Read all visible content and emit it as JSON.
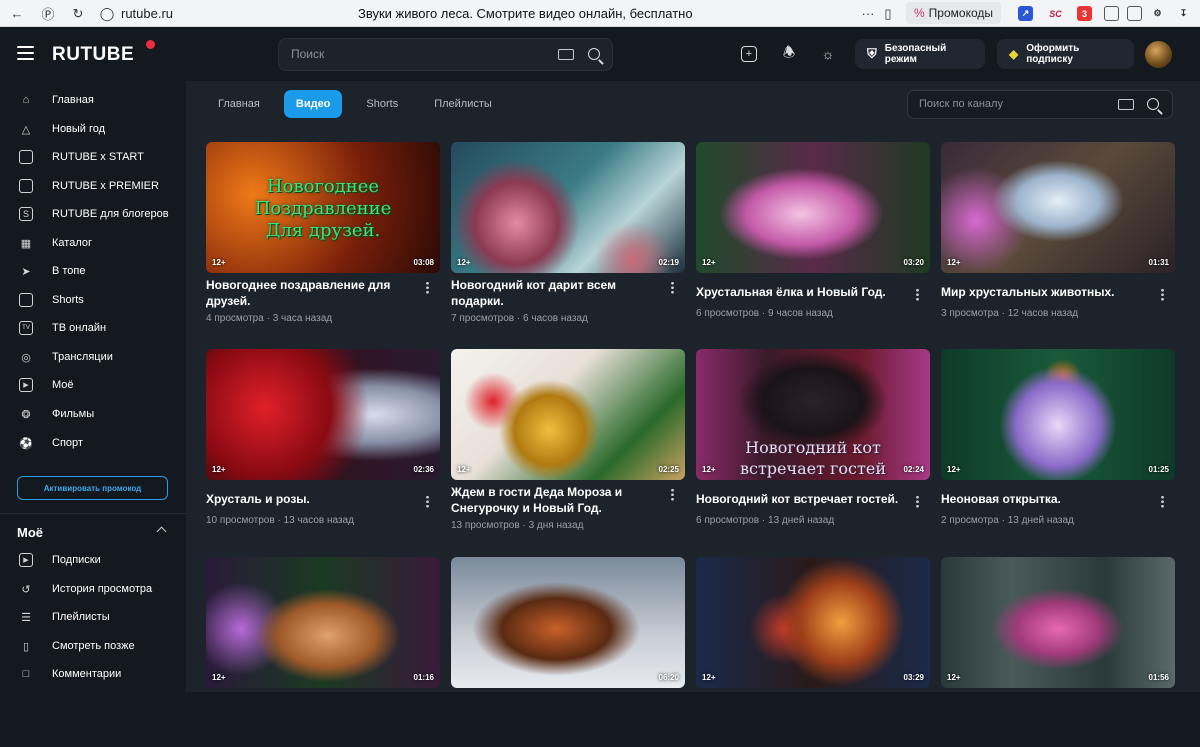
{
  "browser": {
    "url": "rutube.ru",
    "title": "Звуки живого леса. Смотрите видео онлайн, бесплатно",
    "promo_label": "Промокоды",
    "ext_badge": "3"
  },
  "header": {
    "logo": "RUTUBE",
    "search_placeholder": "Поиск",
    "safe_mode": "Безопасный режим",
    "subscribe": "Оформить подписку"
  },
  "sidebar": {
    "items": [
      {
        "label": "Главная",
        "icon": "home-icon"
      },
      {
        "label": "Новый год",
        "icon": "tree-icon"
      },
      {
        "label": "RUTUBE x START",
        "icon": "start-icon"
      },
      {
        "label": "RUTUBE x PREMIER",
        "icon": "premier-icon"
      },
      {
        "label": "RUTUBE для блогеров",
        "icon": "bloggers-icon"
      },
      {
        "label": "Каталог",
        "icon": "catalog-icon"
      },
      {
        "label": "В топе",
        "icon": "rocket-icon"
      },
      {
        "label": "Shorts",
        "icon": "shorts-icon"
      },
      {
        "label": "ТВ онлайн",
        "icon": "tv-icon"
      },
      {
        "label": "Трансляции",
        "icon": "broadcast-icon"
      },
      {
        "label": "Моё",
        "icon": "my-icon"
      },
      {
        "label": "Фильмы",
        "icon": "films-icon"
      },
      {
        "label": "Спорт",
        "icon": "sport-icon"
      }
    ],
    "promo_button": "Активировать промокод",
    "my_heading": "Моё",
    "my_items": [
      {
        "label": "Подписки",
        "icon": "subscriptions-icon"
      },
      {
        "label": "История просмотра",
        "icon": "history-icon"
      },
      {
        "label": "Плейлисты",
        "icon": "playlists-icon"
      },
      {
        "label": "Смотреть позже",
        "icon": "bookmark-icon"
      },
      {
        "label": "Комментарии",
        "icon": "comments-icon"
      }
    ]
  },
  "tabs": [
    {
      "label": "Главная",
      "active": false
    },
    {
      "label": "Видео",
      "active": true
    },
    {
      "label": "Shorts",
      "active": false
    },
    {
      "label": "Плейлисты",
      "active": false
    }
  ],
  "channel_search_placeholder": "Поиск по каналу",
  "videos": [
    {
      "title": "Новогоднее поздравление для друзей.",
      "views": "4 просмотра",
      "ago": "3 часа назад",
      "age": "12+",
      "duration": "03:08",
      "overlay": "Новогоднее Поздравление Для друзей."
    },
    {
      "title": "Новогодний кот дарит всем подарки.",
      "views": "7 просмотров",
      "ago": "6 часов назад",
      "age": "12+",
      "duration": "02:19"
    },
    {
      "title": "Хрустальная ёлка и Новый Год.",
      "views": "6 просмотров",
      "ago": "9 часов назад",
      "age": "12+",
      "duration": "03:20"
    },
    {
      "title": "Мир хрустальных животных.",
      "views": "3 просмотра",
      "ago": "12 часов назад",
      "age": "12+",
      "duration": "01:31"
    },
    {
      "title": "Хрусталь и розы.",
      "views": "10 просмотров",
      "ago": "13 часов назад",
      "age": "12+",
      "duration": "02:36"
    },
    {
      "title": "Ждем в гости Деда Мороза и Снегурочку и Новый Год.",
      "views": "13 просмотров",
      "ago": "3 дня назад",
      "age": "12+",
      "duration": "02:25"
    },
    {
      "title": "Новогодний кот встречает гостей.",
      "views": "6 просмотров",
      "ago": "13 дней назад",
      "age": "12+",
      "duration": "02:24",
      "overlay": "Новогодний кот встречает гостей"
    },
    {
      "title": "Неоновая открытка.",
      "views": "2 просмотра",
      "ago": "13 дней назад",
      "age": "12+",
      "duration": "01:25"
    },
    {
      "title": "",
      "views": "",
      "ago": "",
      "age": "12+",
      "duration": "01:16"
    },
    {
      "title": "",
      "views": "",
      "ago": "",
      "age": "",
      "duration": "06:20"
    },
    {
      "title": "",
      "views": "",
      "ago": "",
      "age": "12+",
      "duration": "03:29"
    },
    {
      "title": "",
      "views": "",
      "ago": "",
      "age": "12+",
      "duration": "01:56"
    }
  ],
  "colors": {
    "accent": "#1a9bea",
    "background": "#1d232a",
    "sidebar": "#14191f",
    "logo_dot": "#ee2c40"
  }
}
